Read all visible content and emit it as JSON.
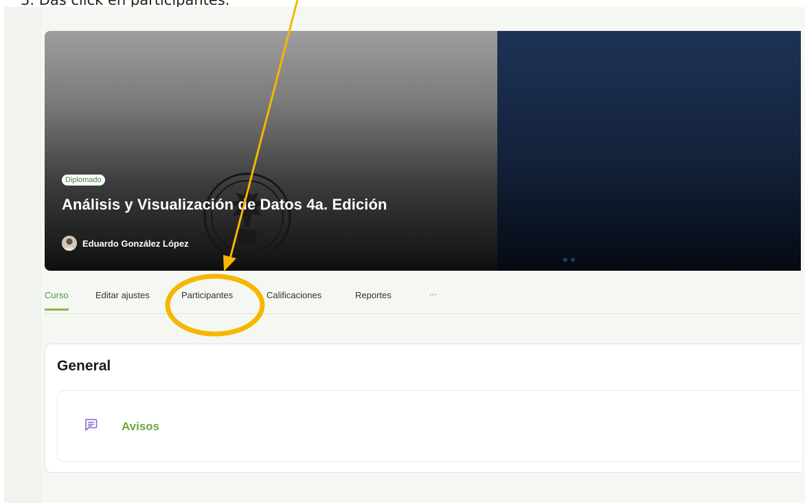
{
  "instruction": "3.  Das click en participantes.",
  "hero": {
    "badge": "Diplomado",
    "course_title": "Análisis y Visualización de Datos 4a. Edición",
    "author_name": "Eduardo González López"
  },
  "tabs": [
    {
      "label": "Curso",
      "active": true
    },
    {
      "label": "Editar ajustes",
      "active": false
    },
    {
      "label": "Participantes",
      "active": false
    },
    {
      "label": "Calificaciones",
      "active": false
    },
    {
      "label": "Reportes",
      "active": false
    },
    {
      "label": "···",
      "active": false
    }
  ],
  "section": {
    "title": "General",
    "activities": [
      {
        "label": "Avisos",
        "icon": "forum-icon"
      }
    ]
  },
  "colors": {
    "accent_green": "#6aa83a",
    "annotation_yellow": "#f5b700",
    "forum_icon_purple": "#8a63d2"
  }
}
